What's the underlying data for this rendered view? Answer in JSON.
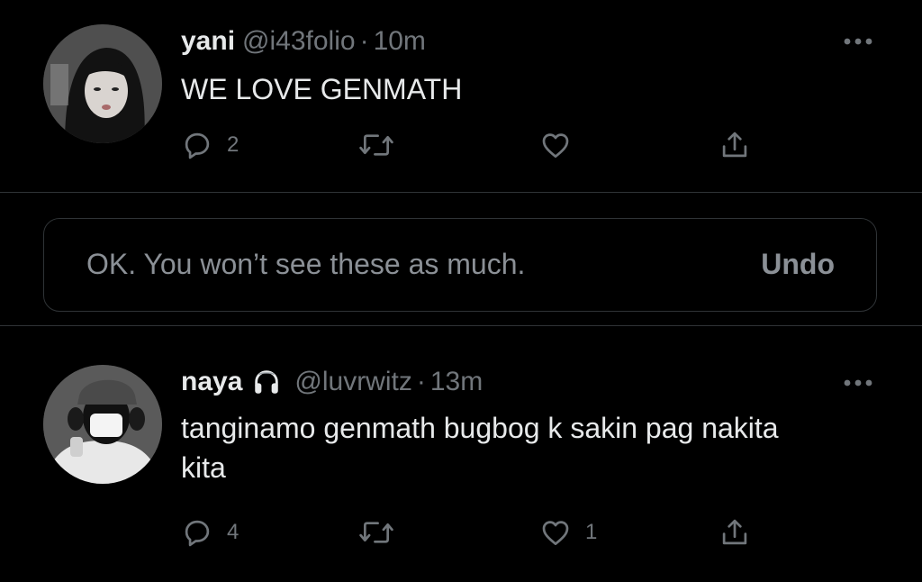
{
  "tweets": [
    {
      "display_name": "yani",
      "handle": "@i43folio",
      "separator": "·",
      "time": "10m",
      "text": "WE LOVE GENMATH",
      "reply_count": "2",
      "retweet_count": "",
      "like_count": ""
    },
    {
      "display_name": "naya",
      "badge_icon": "headphones-icon",
      "handle": "@luvrwitz",
      "separator": "·",
      "time": "13m",
      "text": "tanginamo genmath bugbog k sakin pag nakita kita",
      "reply_count": "4",
      "retweet_count": "",
      "like_count": "1"
    }
  ],
  "notice": {
    "text": "OK. You won’t see these as much.",
    "undo_label": "Undo"
  },
  "colors": {
    "background": "#000000",
    "primary_text": "#e7e9ea",
    "secondary_text": "#71767b",
    "divider": "#2f3336"
  }
}
